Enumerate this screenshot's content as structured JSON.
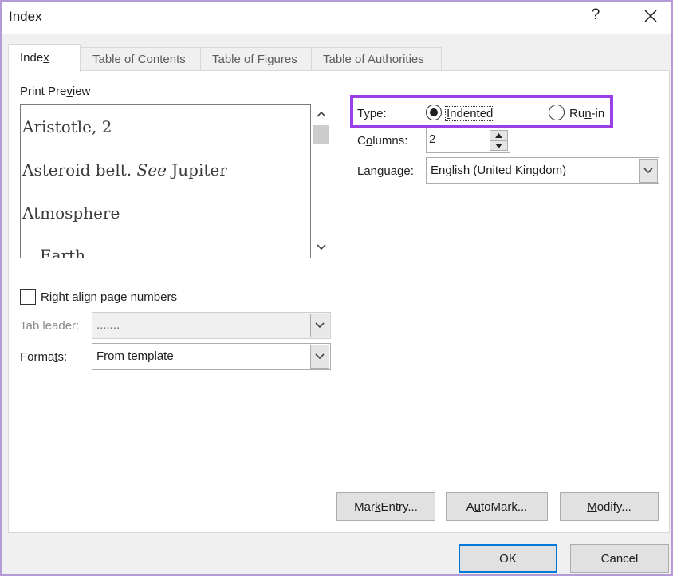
{
  "window": {
    "title": "Index",
    "help_label": "?"
  },
  "tabs": [
    {
      "label_pre": "Inde",
      "label_key": "x",
      "label_post": "",
      "active": true
    },
    {
      "label": "Table of Contents",
      "active": false
    },
    {
      "label": "Table of Figures",
      "active": false
    },
    {
      "label": "Table of Authorities",
      "active": false
    }
  ],
  "print_preview": {
    "label_pre": "Print Pre",
    "label_key": "v",
    "label_post": "iew",
    "entries": [
      {
        "text": "Aristotle, 2"
      },
      {
        "text_pre": "Asteroid belt. ",
        "text_italic": "See",
        "text_post": " Jupiter"
      },
      {
        "text": "Atmosphere"
      },
      {
        "text": "Earth"
      }
    ]
  },
  "right_align": {
    "checked": false,
    "label_key": "R",
    "label_post": "ight align page numbers"
  },
  "tab_leader": {
    "label": "Tab leader:",
    "value": ".......",
    "disabled": true
  },
  "formats": {
    "label_pre": "Forma",
    "label_key": "t",
    "label_post": "s:",
    "value": "From template"
  },
  "type": {
    "label": "Type:",
    "options": [
      {
        "label_pre": "",
        "label_key": "I",
        "label_post": "ndented",
        "selected": true
      },
      {
        "label_pre": "Ru",
        "label_key": "n",
        "label_post": "-in",
        "selected": false
      }
    ]
  },
  "columns": {
    "label_pre": "C",
    "label_key": "o",
    "label_post": "lumns:",
    "value": "2"
  },
  "language": {
    "label_pre": "",
    "label_key": "L",
    "label_post": "anguage:",
    "value": "English (United Kingdom)"
  },
  "buttons": {
    "mark_entry": {
      "pre": "Mar",
      "key": "k",
      "post": " Entry..."
    },
    "automark": {
      "pre": "A",
      "key": "u",
      "post": "toMark..."
    },
    "modify": {
      "pre": "",
      "key": "M",
      "post": "odify..."
    },
    "ok": "OK",
    "cancel": "Cancel"
  },
  "colors": {
    "highlight_border": "#9b3fe6",
    "default_button_border": "#0078d7"
  }
}
